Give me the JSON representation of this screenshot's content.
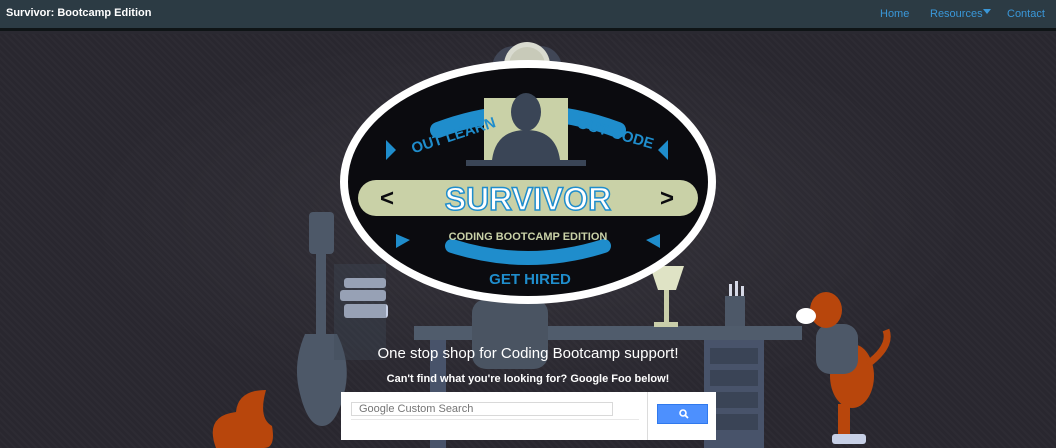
{
  "navbar": {
    "brand": "Survivor: Bootcamp Edition",
    "links": [
      {
        "label": "Home"
      },
      {
        "label": "Resources",
        "dropdown": true
      },
      {
        "label": "Contact"
      }
    ]
  },
  "logo": {
    "top_left": "OUT LEARN",
    "top_right": "OUT CODE",
    "title": "SURVIVOR",
    "subtitle": "CODING BOOTCAMP EDITION",
    "bottom": "GET HIRED"
  },
  "hero": {
    "tagline": "One stop shop for Coding Bootcamp support!",
    "subtag": "Can't find what you're looking for? Google Foo below!"
  },
  "search": {
    "placeholder": "Google Custom Search",
    "button_icon": "search-icon"
  },
  "colors": {
    "navbar_bg": "#2c3b44",
    "nav_link": "#3a97d8",
    "hero_bg": "#29272f",
    "logo_blue": "#1f8dcc",
    "logo_cream": "#c9d1a7",
    "search_button": "#4d90fe"
  }
}
